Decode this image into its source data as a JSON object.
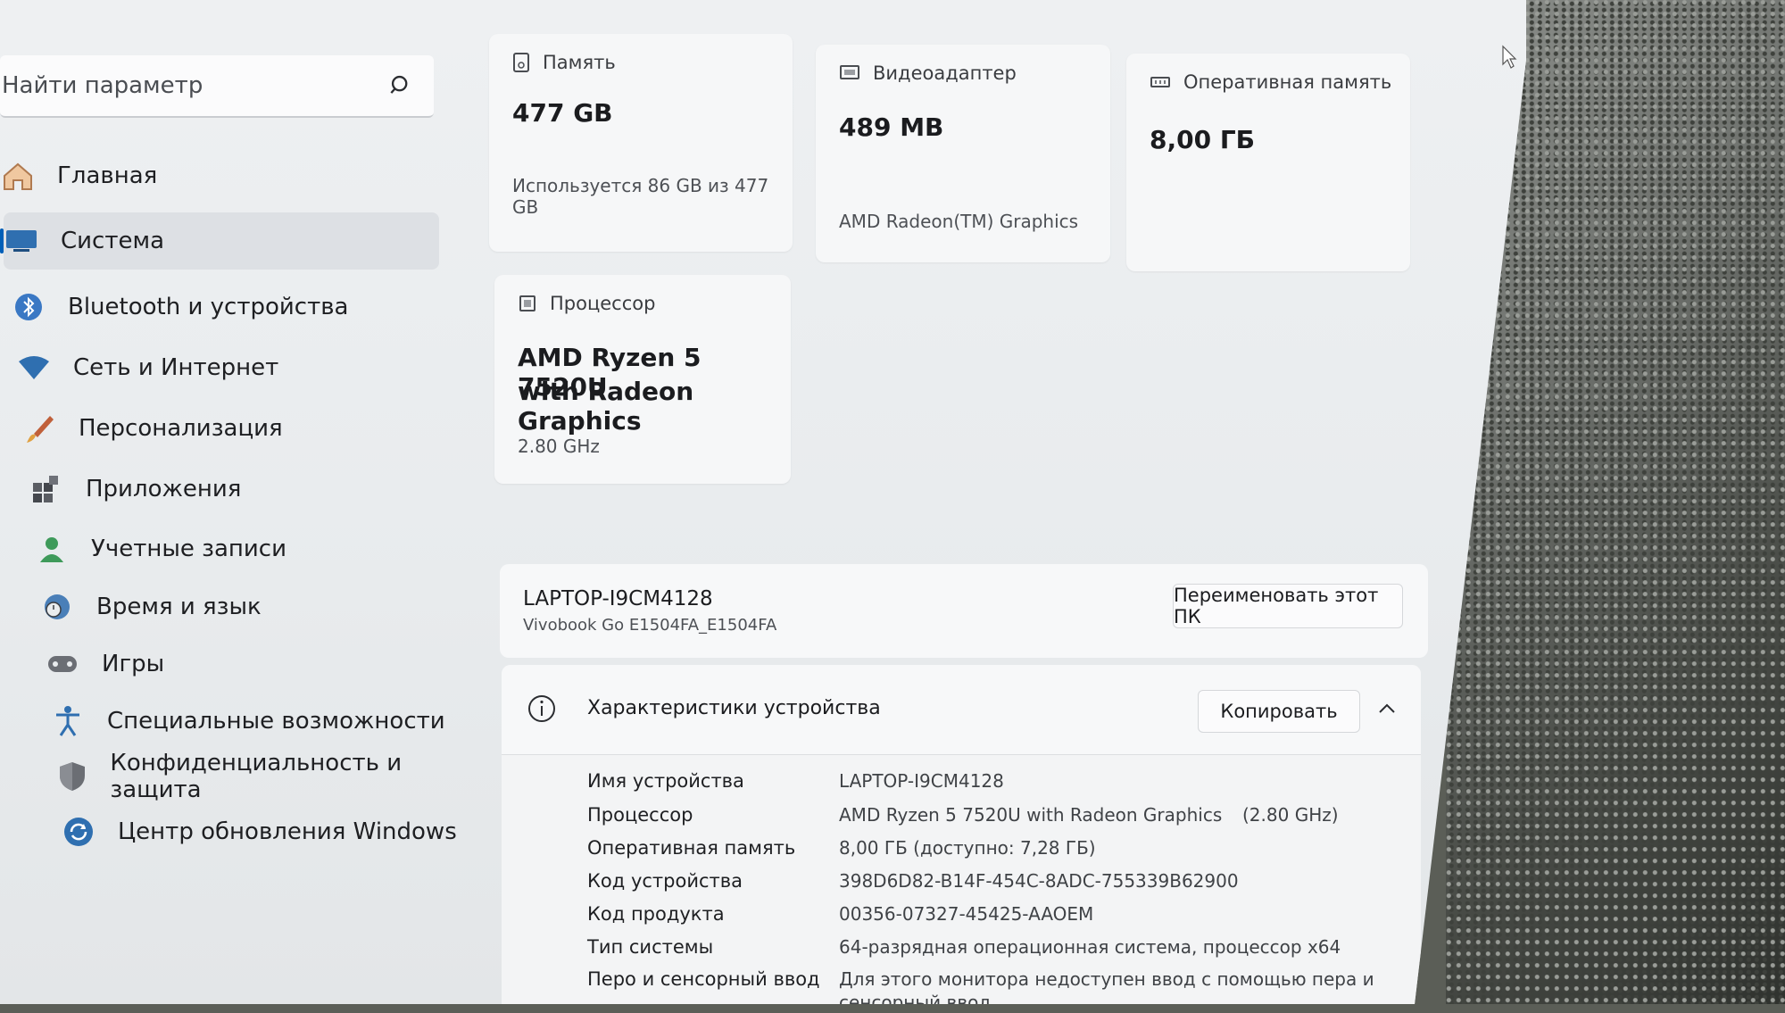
{
  "search": {
    "placeholder": "Найти параметр"
  },
  "sidebar": {
    "items": [
      {
        "label": "Главная",
        "icon": "home-icon"
      },
      {
        "label": "Система",
        "icon": "system-icon",
        "active": true
      },
      {
        "label": "Bluetooth и устройства",
        "icon": "bluetooth-icon"
      },
      {
        "label": "Сеть и Интернет",
        "icon": "wifi-icon"
      },
      {
        "label": "Персонализация",
        "icon": "brush-icon"
      },
      {
        "label": "Приложения",
        "icon": "apps-icon"
      },
      {
        "label": "Учетные записи",
        "icon": "user-icon"
      },
      {
        "label": "Время и язык",
        "icon": "clock-globe-icon"
      },
      {
        "label": "Игры",
        "icon": "gamepad-icon"
      },
      {
        "label": "Специальные возможности",
        "icon": "accessibility-icon"
      },
      {
        "label": "Конфиденциальность и защита",
        "icon": "shield-icon"
      },
      {
        "label": "Центр обновления Windows",
        "icon": "update-icon"
      }
    ]
  },
  "cards": {
    "storage": {
      "title": "Память",
      "value": "477 GB",
      "sub": "Используется 86 GB из 477 GB"
    },
    "gpu": {
      "title": "Видеоадаптер",
      "value": "489 MB",
      "sub": "AMD Radeon(TM) Graphics"
    },
    "ram": {
      "title": "Оперативная память",
      "value": "8,00 ГБ"
    },
    "cpu": {
      "title": "Процессор",
      "value_line1": "AMD Ryzen 5 7520U",
      "value_line2": "with Radeon Graphics",
      "sub": "2.80 GHz"
    }
  },
  "pc": {
    "name": "LAPTOP-I9CM4128",
    "model": "Vivobook Go E1504FA_E1504FA",
    "rename_label": "Переименовать этот ПК"
  },
  "specs": {
    "title": "Характеристики устройства",
    "copy_label": "Копировать",
    "rows": [
      {
        "label": "Имя устройства",
        "value": "LAPTOP-I9CM4128"
      },
      {
        "label": "Процессор",
        "value": "AMD Ryzen 5 7520U with Radeon Graphics",
        "extra": "(2.80 GHz)"
      },
      {
        "label": "Оперативная память",
        "value": "8,00 ГБ (доступно: 7,28 ГБ)"
      },
      {
        "label": "Код устройства",
        "value": "398D6D82-B14F-454C-8ADC-755339B62900"
      },
      {
        "label": "Код продукта",
        "value": "00356-07327-45425-AAOEM"
      },
      {
        "label": "Тип системы",
        "value": "64-разрядная операционная система, процессор x64"
      },
      {
        "label": "Перо и сенсорный ввод",
        "value": "Для этого монитора недоступен ввод с помощью пера и",
        "value2": "сенсорный ввод"
      }
    ]
  },
  "colors": {
    "accent": "#005fb8",
    "window_bg": "#eef0f2",
    "card_bg": "#f6f7f8"
  }
}
